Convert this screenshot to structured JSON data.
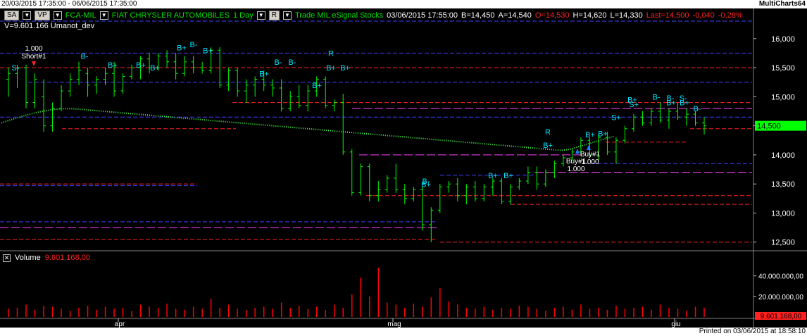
{
  "titlebar": {
    "range": "20/03/2015 17:35:00 - 06/06/2015 17:35:00",
    "brand": "MultiCharts64"
  },
  "header": {
    "btn_sa": "SA",
    "btn_vp": "VP",
    "btn_r": "R",
    "symbol": "FCA-MIL",
    "company": "FIAT CHRYSLER AUTOMOBILES",
    "interval": "1 Day",
    "source": "Trade  MIL  eSignal  Stocks",
    "datetime": "03/06/2015  17:55:00",
    "bid": "B=14,450",
    "ask": "A=14,540",
    "open": "O=14,530",
    "high": "H=14,620",
    "low": "L=14,330",
    "last": "Last=14,500",
    "change": "-0,040",
    "pct": "-0,28%"
  },
  "subheader": {
    "volume_text": "V=9.601.166  Umanot_dev"
  },
  "price_axis": {
    "ticks": [
      "16,000",
      "15,500",
      "15,000",
      "14,500",
      "14,000",
      "13,500",
      "13,000",
      "12,500"
    ],
    "ylim": [
      12.4,
      16.3
    ],
    "last_badge": "14,500"
  },
  "volume_pane": {
    "label": "Volume",
    "value": "9.601.168,00",
    "ticks": [
      "40.000.000,00",
      "20.000.000,00"
    ],
    "badge": "9.601.168,00"
  },
  "time_axis": {
    "labels": [
      "apr",
      "mag",
      "giu"
    ]
  },
  "footer": {
    "printed": "Printed on 03/06/2015 at 18:58:10"
  },
  "annotations": {
    "short_qty": "1.000",
    "short_label": "Short#1",
    "buy_label": "Buy#1",
    "buy_qty": "1.000",
    "buy2_label": "Buy#1",
    "buy2_qty": "1.000"
  },
  "colors": {
    "up": "#00ff00",
    "signal": "#00e5ff",
    "last": "#ff2020",
    "volume": "#ff0000"
  },
  "chart_data": {
    "type": "bar",
    "title": "FCA-MIL 1 Day",
    "ylim": [
      12.4,
      16.3
    ],
    "bars": [
      [
        15.3,
        15.5,
        15.0,
        15.4
      ],
      [
        15.4,
        15.55,
        15.15,
        15.5
      ],
      [
        15.5,
        15.55,
        14.8,
        14.9
      ],
      [
        14.9,
        15.4,
        14.8,
        15.3
      ],
      [
        15.0,
        15.3,
        14.4,
        14.5
      ],
      [
        14.5,
        14.9,
        14.4,
        14.8
      ],
      [
        14.8,
        15.2,
        14.75,
        15.1
      ],
      [
        15.1,
        15.4,
        15.0,
        15.3
      ],
      [
        15.3,
        15.6,
        15.2,
        15.45
      ],
      [
        15.4,
        15.5,
        15.0,
        15.2
      ],
      [
        15.2,
        15.35,
        15.05,
        15.3
      ],
      [
        15.3,
        15.5,
        15.2,
        15.4
      ],
      [
        15.4,
        15.6,
        15.0,
        15.1
      ],
      [
        15.1,
        15.4,
        15.05,
        15.35
      ],
      [
        15.35,
        15.55,
        15.3,
        15.5
      ],
      [
        15.5,
        15.7,
        15.3,
        15.65
      ],
      [
        15.65,
        15.75,
        15.4,
        15.5
      ],
      [
        15.5,
        15.75,
        15.45,
        15.7
      ],
      [
        15.7,
        15.8,
        15.5,
        15.6
      ],
      [
        15.6,
        15.75,
        15.3,
        15.4
      ],
      [
        15.4,
        15.7,
        15.35,
        15.6
      ],
      [
        15.6,
        15.7,
        15.4,
        15.5
      ],
      [
        15.5,
        15.6,
        15.4,
        15.45
      ],
      [
        15.45,
        15.85,
        15.4,
        15.8
      ],
      [
        15.8,
        15.85,
        15.15,
        15.2
      ],
      [
        15.2,
        15.5,
        15.1,
        15.45
      ],
      [
        15.45,
        15.5,
        15.0,
        15.1
      ],
      [
        15.1,
        15.3,
        14.9,
        15.2
      ],
      [
        15.2,
        15.35,
        15.0,
        15.3
      ],
      [
        15.3,
        15.45,
        15.1,
        15.2
      ],
      [
        15.2,
        15.3,
        15.0,
        15.15
      ],
      [
        15.15,
        15.3,
        14.75,
        14.8
      ],
      [
        14.8,
        15.1,
        14.75,
        15.0
      ],
      [
        15.0,
        15.2,
        14.8,
        14.85
      ],
      [
        14.85,
        15.2,
        14.75,
        15.1
      ],
      [
        15.1,
        15.35,
        15.0,
        15.3
      ],
      [
        15.3,
        15.35,
        14.8,
        14.85
      ],
      [
        14.85,
        14.95,
        14.75,
        14.9
      ],
      [
        14.9,
        15.05,
        14.0,
        14.05
      ],
      [
        14.05,
        14.1,
        13.3,
        13.35
      ],
      [
        13.35,
        13.85,
        13.3,
        13.8
      ],
      [
        13.8,
        13.85,
        13.2,
        13.3
      ],
      [
        13.3,
        13.55,
        13.2,
        13.4
      ],
      [
        13.4,
        13.65,
        13.35,
        13.6
      ],
      [
        13.6,
        13.85,
        13.35,
        13.4
      ],
      [
        13.4,
        13.5,
        13.15,
        13.25
      ],
      [
        13.25,
        13.45,
        13.2,
        13.4
      ],
      [
        13.4,
        13.45,
        12.7,
        12.8
      ],
      [
        12.8,
        13.1,
        12.5,
        13.05
      ],
      [
        13.05,
        13.5,
        13.0,
        13.45
      ],
      [
        13.45,
        13.55,
        13.35,
        13.5
      ],
      [
        13.5,
        13.6,
        13.2,
        13.3
      ],
      [
        13.3,
        13.5,
        13.15,
        13.45
      ],
      [
        13.45,
        13.55,
        13.2,
        13.25
      ],
      [
        13.25,
        13.5,
        13.2,
        13.45
      ],
      [
        13.45,
        13.6,
        13.3,
        13.55
      ],
      [
        13.55,
        13.6,
        13.15,
        13.2
      ],
      [
        13.2,
        13.5,
        13.15,
        13.45
      ],
      [
        13.45,
        13.6,
        13.4,
        13.55
      ],
      [
        13.55,
        13.8,
        13.5,
        13.7
      ],
      [
        13.7,
        13.8,
        13.4,
        13.5
      ],
      [
        13.5,
        13.75,
        13.45,
        13.7
      ],
      [
        13.7,
        13.9,
        13.6,
        13.85
      ],
      [
        13.85,
        14.0,
        13.8,
        13.95
      ],
      [
        13.95,
        14.1,
        13.9,
        14.05
      ],
      [
        14.05,
        14.3,
        14.0,
        14.25
      ],
      [
        14.25,
        14.3,
        13.95,
        14.0
      ],
      [
        14.0,
        14.35,
        13.9,
        14.3
      ],
      [
        14.3,
        14.4,
        14.0,
        14.05
      ],
      [
        14.05,
        14.3,
        13.85,
        14.25
      ],
      [
        14.25,
        14.5,
        14.2,
        14.45
      ],
      [
        14.45,
        14.7,
        14.4,
        14.65
      ],
      [
        14.65,
        14.75,
        14.5,
        14.55
      ],
      [
        14.55,
        14.8,
        14.5,
        14.75
      ],
      [
        14.75,
        14.9,
        14.55,
        14.6
      ],
      [
        14.6,
        14.8,
        14.45,
        14.75
      ],
      [
        14.75,
        14.9,
        14.6,
        14.65
      ],
      [
        14.65,
        14.8,
        14.5,
        14.7
      ],
      [
        14.7,
        14.75,
        14.5,
        14.55
      ],
      [
        14.55,
        14.65,
        14.35,
        14.5
      ]
    ],
    "volume": [
      8,
      9,
      12,
      7,
      11,
      10,
      8,
      6,
      9,
      11,
      7,
      10,
      8,
      9,
      6,
      12,
      10,
      9,
      13,
      8,
      7,
      10,
      8,
      18,
      9,
      12,
      8,
      7,
      9,
      10,
      8,
      14,
      9,
      11,
      8,
      10,
      7,
      12,
      9,
      22,
      38,
      20,
      48,
      14,
      12,
      9,
      13,
      10,
      19,
      28,
      15,
      12,
      9,
      8,
      10,
      7,
      9,
      8,
      11,
      10,
      8,
      6,
      9,
      10,
      7,
      12,
      8,
      9,
      7,
      11,
      8,
      9,
      10,
      7,
      12,
      9,
      8,
      6,
      10,
      9
    ]
  }
}
